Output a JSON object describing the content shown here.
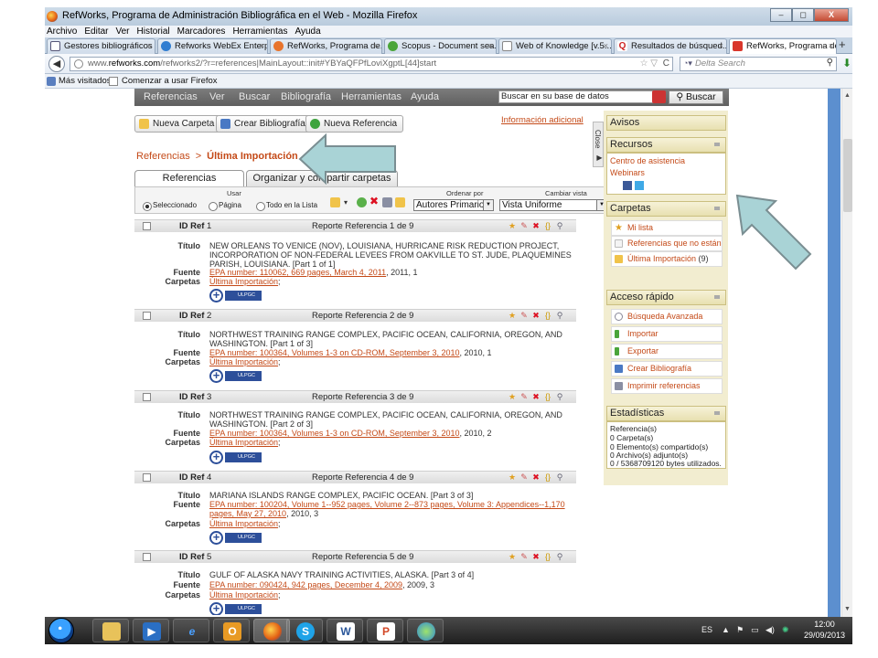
{
  "window": {
    "title": "RefWorks, Programa de Administración Bibliográfica en el Web - Mozilla Firefox",
    "controls": [
      "–",
      "◻",
      "X"
    ]
  },
  "menu": [
    "Archivo",
    "Editar",
    "Ver",
    "Historial",
    "Marcadores",
    "Herramientas",
    "Ayuda"
  ],
  "tabs": [
    {
      "label": "Gestores bibliográficos |...",
      "icon": "refresh-icon"
    },
    {
      "label": "Refworks WebEx Enterp...",
      "icon": "globe-icon"
    },
    {
      "label": "RefWorks, Programa de...",
      "icon": "refworks-icon"
    },
    {
      "label": "Scopus - Document sea...",
      "icon": "scopus-icon"
    },
    {
      "label": "Web of Knowledge [v.5....",
      "icon": "page-icon"
    },
    {
      "label": "Resultados de búsqued...",
      "icon": "q-icon"
    },
    {
      "label": "RefWorks, Programa de...",
      "icon": "refworks-icon",
      "active": true
    }
  ],
  "new_tab": "+",
  "address": {
    "prefix": "www.",
    "domain": "refworks.com",
    "path": "/refworks2/?r=references|MainLayout::init#YBYaQFPfLoviXgptL[44]start"
  },
  "search_engine": {
    "placeholder": "Delta Search"
  },
  "bookmarks": [
    "Más visitados",
    "Comenzar a usar Firefox"
  ],
  "app_nav": [
    "Referencias",
    "Ver",
    "Buscar",
    "Bibliografía",
    "Herramientas",
    "Ayuda"
  ],
  "app_search": {
    "value": "Buscar en su base de datos",
    "button": "Buscar"
  },
  "toolbar": {
    "new_folder": "Nueva Carpeta",
    "create_bib": "Crear Bibliografía",
    "new_ref": "Nueva Referencia",
    "info_link": "Información adicional"
  },
  "breadcrumb": {
    "root": "Referencias",
    "sep": ">",
    "current": "Última Importación"
  },
  "page_tabs": [
    "Referencias",
    "Organizar y compartir carpetas"
  ],
  "tools": {
    "use_label": "Usar",
    "radios": [
      "Seleccionado",
      "Página",
      "Todo en la Lista"
    ],
    "sort_label": "Ordenar por",
    "sort_value": "Autores Primarios",
    "view_label": "Cambiar vista",
    "view_value": "Vista Uniforme"
  },
  "ref_labels": {
    "id": "ID Ref",
    "title": "Título",
    "source": "Fuente",
    "folders": "Carpetas"
  },
  "references": [
    {
      "id": "1",
      "report": "Reporte Referencia 1 de 9",
      "title": "NEW ORLEANS TO VENICE (NOV), LOUISIANA, HURRICANE RISK REDUCTION PROJECT, INCORPORATION OF NON-FEDERAL LEVEES FROM OAKVILLE TO ST. JUDE, PLAQUEMINES PARISH, LOUISIANA. [Part 1 of 1]",
      "source_link": "EPA number: 110062, 669 pages, March 4, 2011",
      "source_rest": ", 2011, 1",
      "folder": "Última Importación",
      "folder_suffix": ";"
    },
    {
      "id": "2",
      "report": "Reporte Referencia 2 de 9",
      "title": "NORTHWEST TRAINING RANGE COMPLEX, PACIFIC OCEAN, CALIFORNIA, OREGON, AND WASHINGTON. [Part 1 of 3]",
      "source_link": "EPA number: 100364, Volumes 1-3 on CD-ROM, September 3, 2010",
      "source_rest": ", 2010, 1",
      "folder": "Última Importación",
      "folder_suffix": ";"
    },
    {
      "id": "3",
      "report": "Reporte Referencia 3 de 9",
      "title": "NORTHWEST TRAINING RANGE COMPLEX, PACIFIC OCEAN, CALIFORNIA, OREGON, AND WASHINGTON. [Part 2 of 3]",
      "source_link": "EPA number: 100364, Volumes 1-3 on CD-ROM, September 3, 2010",
      "source_rest": ", 2010, 2",
      "folder": "Última Importación",
      "folder_suffix": ";"
    },
    {
      "id": "4",
      "report": "Reporte Referencia 4 de 9",
      "title": "MARIANA ISLANDS RANGE COMPLEX, PACIFIC OCEAN. [Part 3 of 3]",
      "source_link": "EPA number: 100204, Volume 1--952 pages, Volume 2--873 pages, Volume 3: Appendices--1,170 pages, May 27, 2010",
      "source_rest": ", 2010, 3",
      "folder": "Última Importación",
      "folder_suffix": ";"
    },
    {
      "id": "5",
      "report": "Reporte Referencia 5 de 9",
      "title": "GULF OF ALASKA NAVY TRAINING ACTIVITIES, ALASKA. [Part 3 of 4]",
      "source_link": "EPA number: 090424, 942 pages, December 4, 2009",
      "source_rest": ", 2009, 3",
      "folder": "Última Importación",
      "folder_suffix": ";"
    }
  ],
  "ulpgc_badge": "ULPGC",
  "sidebar": {
    "close_tab": "Close",
    "avisos": "Avisos",
    "recursos": {
      "title": "Recursos",
      "links": [
        "Centro de asistencia",
        "Webinars"
      ]
    },
    "carpetas": {
      "title": "Carpetas",
      "items": [
        {
          "label": "Mi lista",
          "count": ""
        },
        {
          "label": "Referencias que no están e",
          "count": ""
        },
        {
          "label": "Última Importación",
          "count": "(9)"
        }
      ]
    },
    "acceso": {
      "title": "Acceso rápido",
      "items": [
        "Búsqueda Avanzada",
        "Importar",
        "Exportar",
        "Crear Bibliografía",
        "Imprimir referencias"
      ]
    },
    "estadisticas": {
      "title": "Estadísticas",
      "lines": [
        "Referencia(s)",
        "0 Carpeta(s)",
        "0 Elemento(s) compartido(s)",
        "0 Archivo(s) adjunto(s)",
        "0 / 5368709120 bytes utilizados."
      ]
    }
  },
  "taskbar": {
    "language": "ES",
    "time": "12:00",
    "date": "29/09/2013",
    "apps": [
      "ie-icon",
      "explorer-icon",
      "media-player-icon",
      "internet-explorer-icon",
      "outlook-icon",
      "firefox-icon",
      "skype-icon",
      "word-icon",
      "powerpoint-icon",
      "itunes-icon"
    ]
  },
  "colors": {
    "link": "#c44a18",
    "sidebar_bg": "#f2edd0",
    "callout": "#a9d3d6",
    "header": "#6e6e6e"
  }
}
